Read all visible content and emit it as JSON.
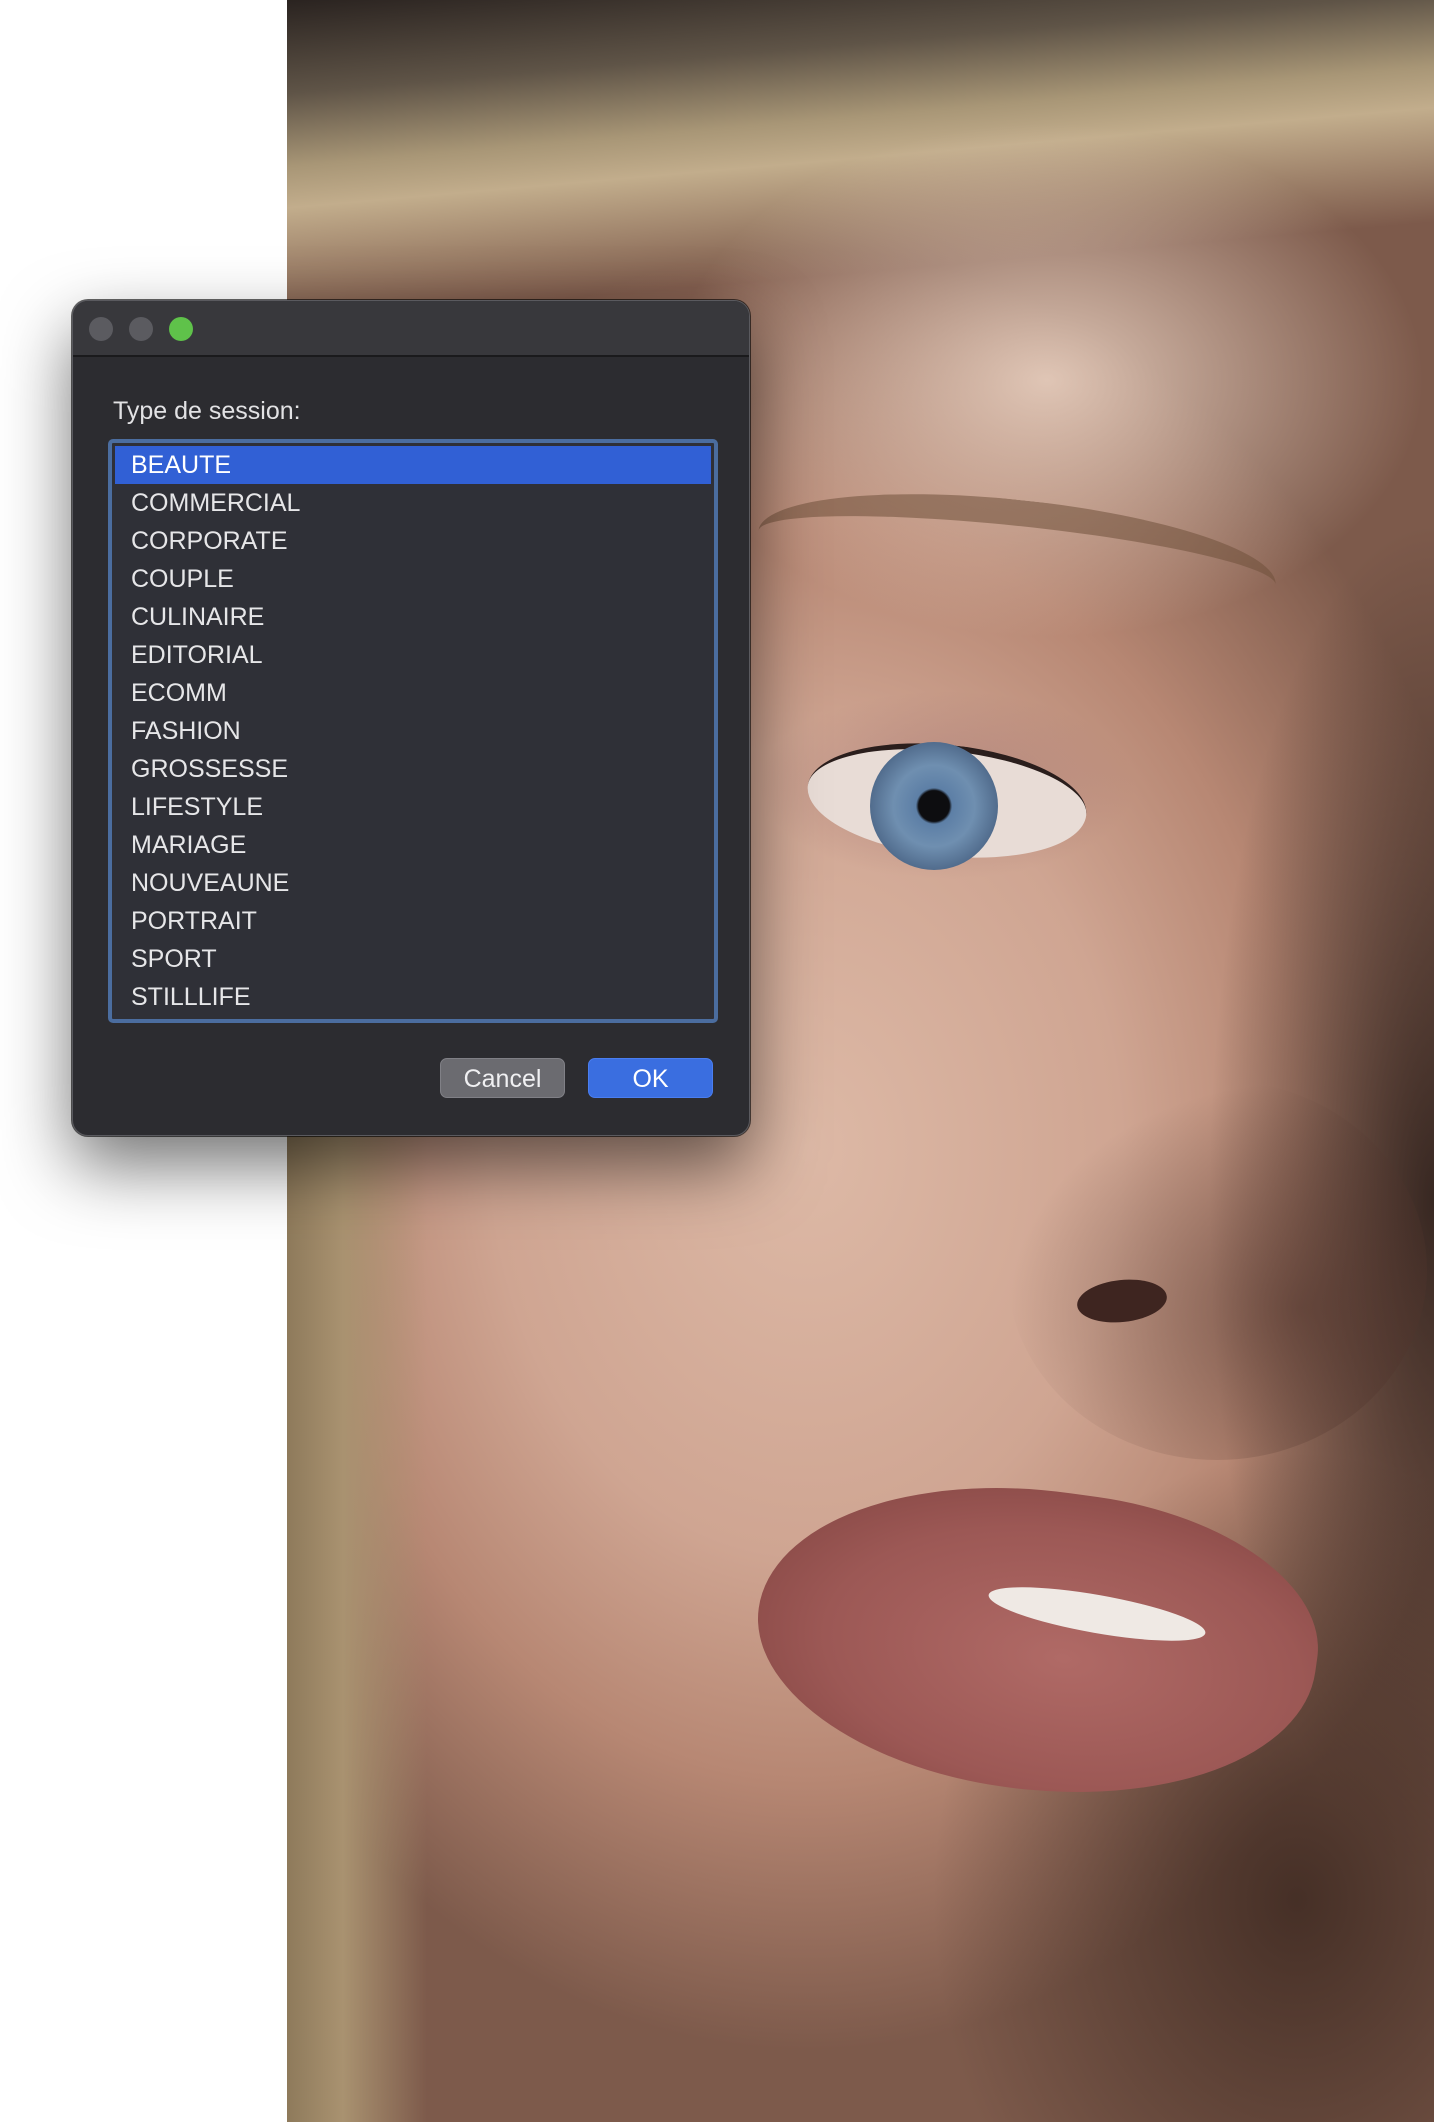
{
  "dialog": {
    "label": "Type de session:",
    "items": [
      {
        "label": "BEAUTE",
        "selected": true
      },
      {
        "label": "COMMERCIAL",
        "selected": false
      },
      {
        "label": "CORPORATE",
        "selected": false
      },
      {
        "label": "COUPLE",
        "selected": false
      },
      {
        "label": "CULINAIRE",
        "selected": false
      },
      {
        "label": "EDITORIAL",
        "selected": false
      },
      {
        "label": "ECOMM",
        "selected": false
      },
      {
        "label": "FASHION",
        "selected": false
      },
      {
        "label": "GROSSESSE",
        "selected": false
      },
      {
        "label": "LIFESTYLE",
        "selected": false
      },
      {
        "label": "MARIAGE",
        "selected": false
      },
      {
        "label": "NOUVEAUNE",
        "selected": false
      },
      {
        "label": "PORTRAIT",
        "selected": false
      },
      {
        "label": "SPORT",
        "selected": false
      },
      {
        "label": "STILLLIFE",
        "selected": false
      }
    ],
    "cancel_label": "Cancel",
    "ok_label": "OK"
  },
  "colors": {
    "selection": "#3160d5",
    "ok_button": "#3a6ee0",
    "zoom_light": "#5fc24a",
    "dialog_bg": "#2c2c30"
  },
  "icons": {
    "close": "close-window-icon",
    "minimize": "minimize-window-icon",
    "zoom": "zoom-window-icon"
  }
}
